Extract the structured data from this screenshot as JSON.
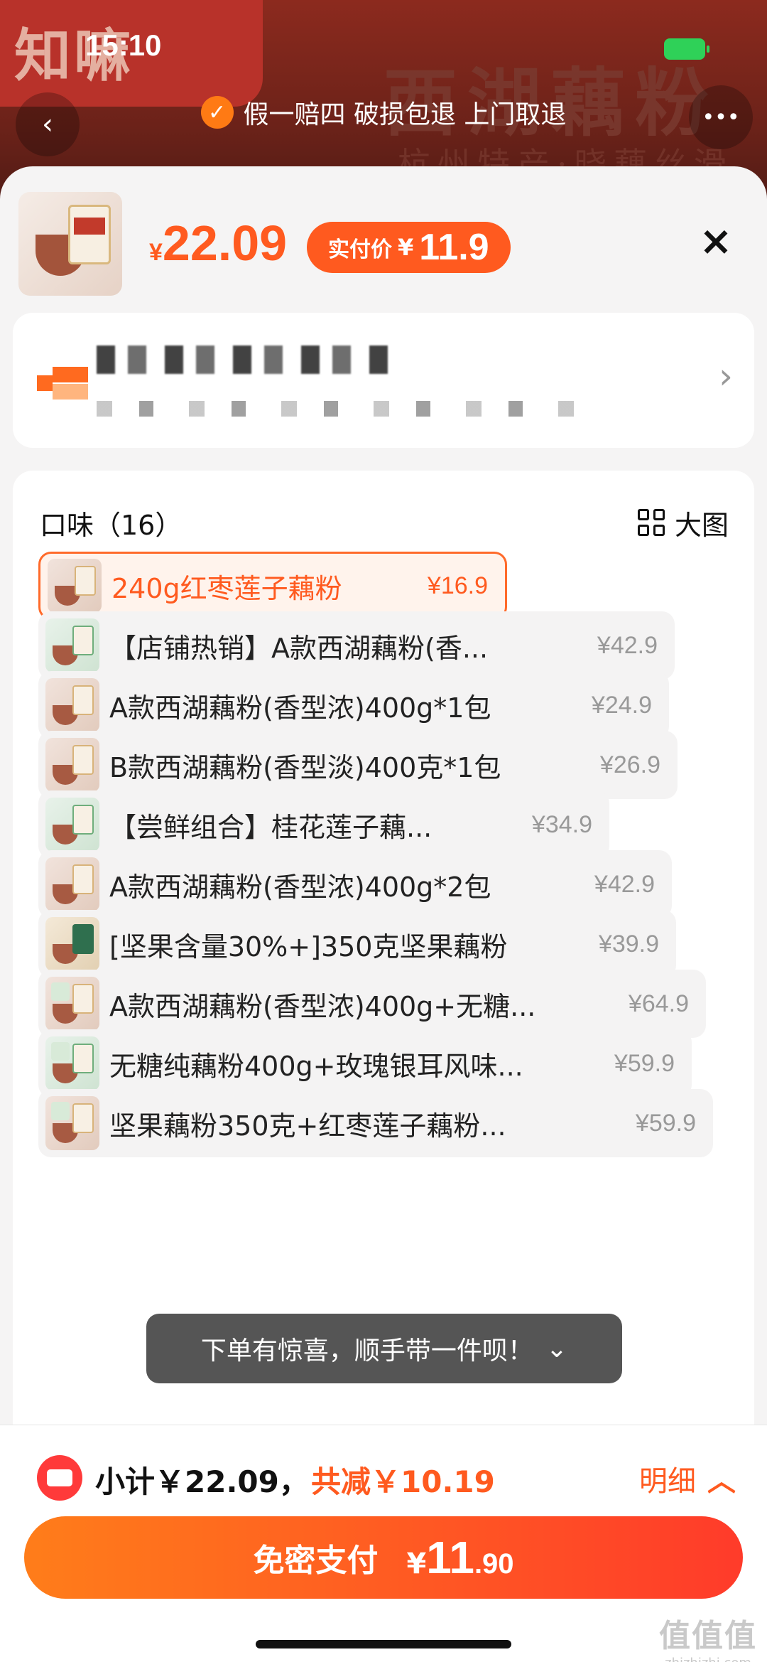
{
  "status_bar": {
    "time": "15:10"
  },
  "background": {
    "brand_text": "知嘛",
    "banner_title": "西湖藕粉",
    "banner_subtitle": "杭州特产·晓藕丝滑"
  },
  "guarantee": {
    "text": "假一赔四 破损包退 上门取退"
  },
  "header": {
    "price_currency": "¥",
    "price": "22.09",
    "paid_label": "实付价",
    "paid_currency": "¥",
    "paid_price": "11.9",
    "close_icon": "×"
  },
  "options": {
    "title": "口味（16）",
    "big_view": "大图",
    "items": [
      {
        "label": "240g红枣莲子藕粉",
        "price": "¥16.9",
        "selected": true
      },
      {
        "label": "【店铺热销】A款西湖藕粉(香...",
        "price": "¥42.9"
      },
      {
        "label": "A款西湖藕粉(香型浓)400g*1包",
        "price": "¥24.9"
      },
      {
        "label": "B款西湖藕粉(香型淡)400克*1包",
        "price": "¥26.9"
      },
      {
        "label": "【尝鲜组合】桂花莲子藕...",
        "price": "¥34.9"
      },
      {
        "label": "A款西湖藕粉(香型浓)400g*2包",
        "price": "¥42.9"
      },
      {
        "label": "[坚果含量30%+]350克坚果藕粉",
        "price": "¥39.9"
      },
      {
        "label": "A款西湖藕粉(香型浓)400g+无糖...",
        "price": "¥64.9"
      },
      {
        "label": "无糖纯藕粉400g+玫瑰银耳风味...",
        "price": "¥59.9"
      },
      {
        "label": "坚果藕粉350克+红枣莲子藕粉...",
        "price": "¥59.9"
      }
    ]
  },
  "toast": {
    "text": "下单有惊喜，顺手带一件呗！",
    "icon": "⌄"
  },
  "bottom": {
    "subtotal": "小计￥22.09，",
    "reduce": "共减￥10.19",
    "detail": "明细",
    "pay_label": "免密支付",
    "pay_currency": "¥",
    "pay_int": "11",
    "pay_dec": ".90"
  },
  "watermark": {
    "big": "值值值",
    "small": "zhizhizhi.com"
  }
}
